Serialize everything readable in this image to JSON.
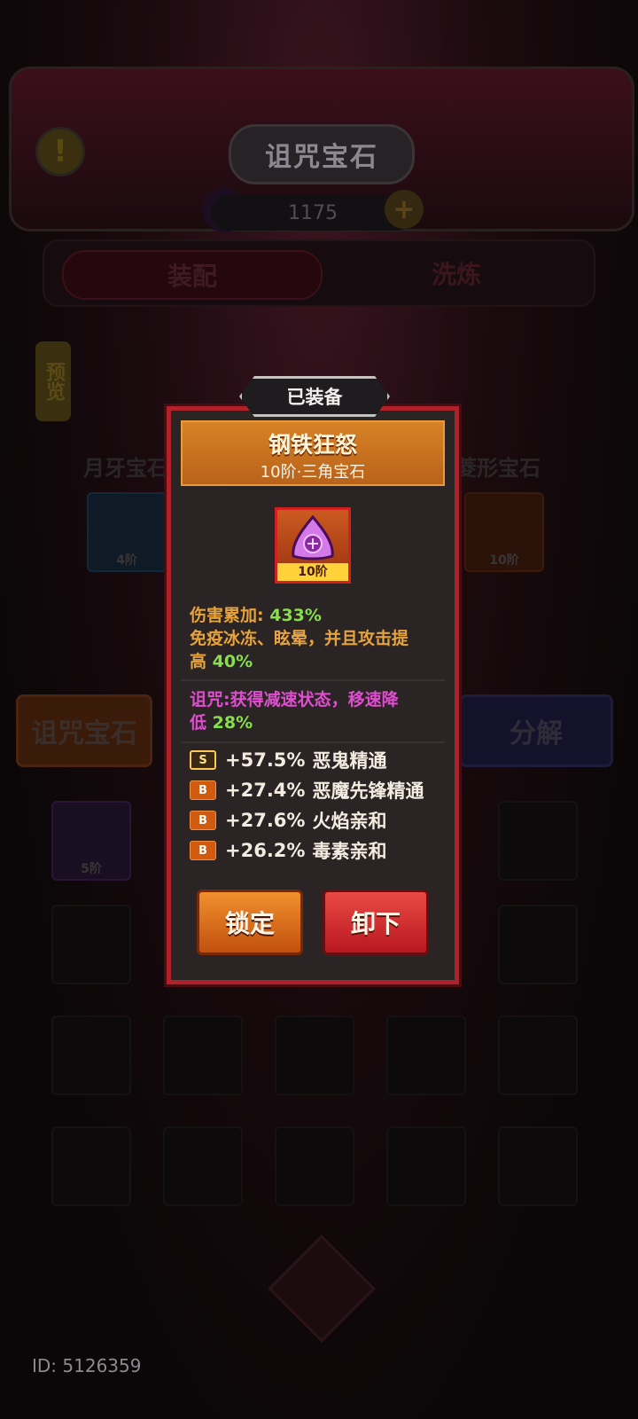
{
  "header": {
    "title": "诅咒宝石",
    "currency_value": "1175"
  },
  "tabs": {
    "assemble": "装配",
    "refine": "洗炼"
  },
  "preview_label": "预览",
  "slots": {
    "left_label": "月牙宝石",
    "left_level": "4阶",
    "right_label": "菱形宝石",
    "right_level": "10阶"
  },
  "actions": {
    "curse_gem": "诅咒宝石",
    "decompose": "分解"
  },
  "inventory": {
    "first_level": "5阶"
  },
  "popup": {
    "equipped_label": "已装备",
    "gem_name": "钢铁狂怒",
    "gem_subtitle": "10阶·三角宝石",
    "gem_level": "10阶",
    "effect_label": "伤害累加:",
    "effect_value": "433%",
    "effect_line2": "免疫冰冻、眩晕，并且攻击提",
    "effect_line3_prefix": "高",
    "effect_line3_value": "40%",
    "curse_line1": "诅咒:获得减速状态，移速降",
    "curse_line2_prefix": "低",
    "curse_line2_value": "28%",
    "attributes": [
      {
        "grade": "S",
        "value": "+57.5%",
        "name": "恶鬼精通"
      },
      {
        "grade": "B",
        "value": "+27.4%",
        "name": "恶魔先锋精通"
      },
      {
        "grade": "B",
        "value": "+27.6%",
        "name": "火焰亲和"
      },
      {
        "grade": "B",
        "value": "+26.2%",
        "name": "毒素亲和"
      }
    ],
    "lock_button": "锁定",
    "unequip_button": "卸下"
  },
  "footer": {
    "id_text": "ID: 5126359"
  }
}
